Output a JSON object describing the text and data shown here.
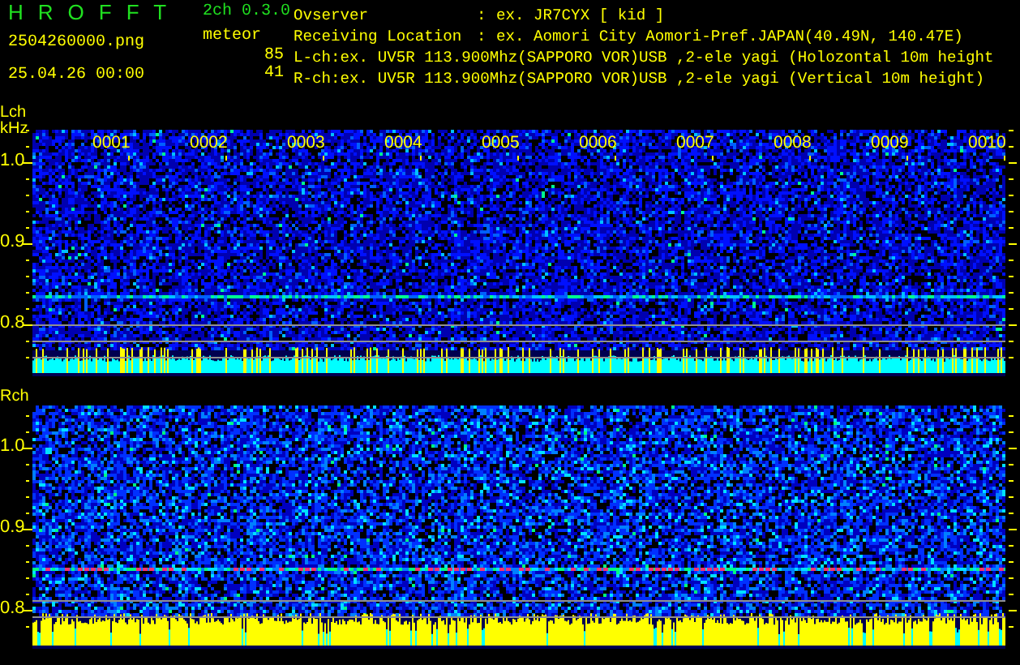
{
  "app": {
    "title": "H R O F F T",
    "version": "2ch 0.3.0",
    "filename": "2504260000.png",
    "datetime": "25.04.26 00:00",
    "mode": "meteor",
    "counts": [
      "85",
      "41"
    ]
  },
  "info": [
    {
      "label": "Ovserver",
      "separator": ":",
      "value": "ex. JR7CYX [ kid ]"
    },
    {
      "label": "Receiving Location",
      "separator": ":",
      "value": "ex. Aomori City Aomori-Pref.JAPAN(40.49N, 140.47E)"
    }
  ],
  "channels_info": [
    "L-ch:ex. UV5R 113.900Mhz(SAPPORO VOR)USB ,2-ele yagi (Holozontal 10m height",
    "R-ch:ex. UV5R 113.900Mhz(SAPPORO VOR)USB ,2-ele yagi (Vertical 10m height)"
  ],
  "panels": [
    {
      "label": "Lch",
      "unit": "kHz",
      "freq_labels": [
        "1.0",
        "0.9",
        "0.8"
      ],
      "time_labels": [
        "0001",
        "0002",
        "0003",
        "0004",
        "0005",
        "0006",
        "0007",
        "0008",
        "0009",
        "0010"
      ]
    },
    {
      "label": "Rch",
      "freq_labels": [
        "1.0",
        "0.9",
        "0.8"
      ]
    }
  ]
}
